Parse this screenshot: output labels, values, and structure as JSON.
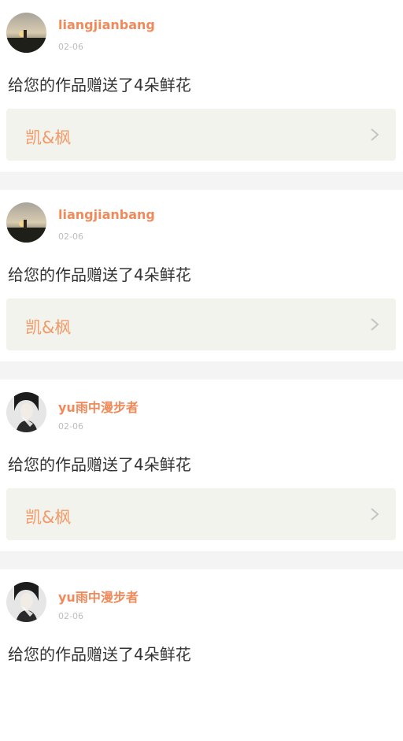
{
  "feed": {
    "items": [
      {
        "username": "liangjianbang",
        "time": "02-06",
        "message": "给您的作品赠送了4朵鲜花",
        "work_title": "凯&枫",
        "avatar_icon": "avatar-sunset-photo"
      },
      {
        "username": "liangjianbang",
        "time": "02-06",
        "message": "给您的作品赠送了4朵鲜花",
        "work_title": "凯&枫",
        "avatar_icon": "avatar-sunset-photo"
      },
      {
        "username": "yu雨中漫步者",
        "time": "02-06",
        "message": "给您的作品赠送了4朵鲜花",
        "work_title": "凯&枫",
        "avatar_icon": "avatar-portrait-photo"
      },
      {
        "username": "yu雨中漫步者",
        "time": "02-06",
        "message": "给您的作品赠送了4朵鲜花",
        "work_title": "",
        "avatar_icon": "avatar-portrait-photo"
      }
    ]
  },
  "colors": {
    "username": "#f08a5a",
    "work_title": "#f39a67",
    "work_box_bg": "#f3f3ee",
    "separator": "#f4f4f4"
  }
}
